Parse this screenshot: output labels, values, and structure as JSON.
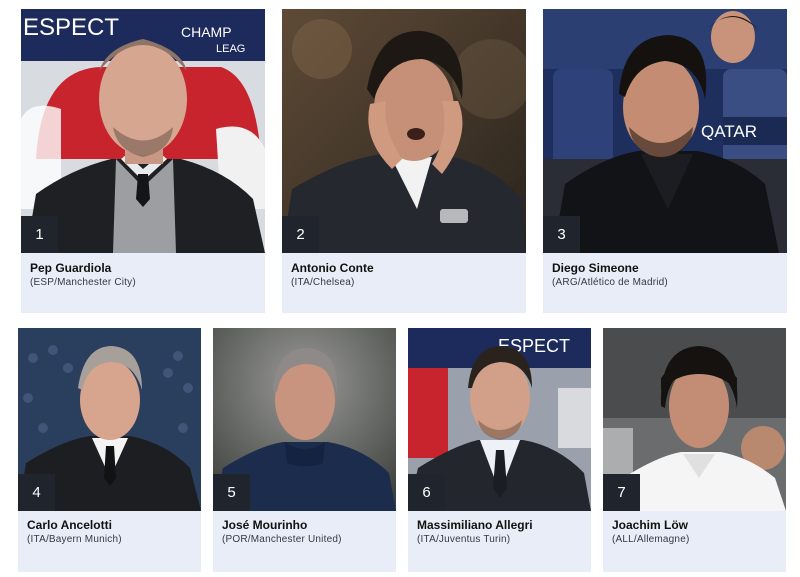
{
  "coaches": [
    {
      "rank": "1",
      "name": "Pep Guardiola",
      "club": "(ESP/Manchester City)",
      "backdrop_text": "ESPECT",
      "backdrop_text2": "CHAMPIONS LEAGUE"
    },
    {
      "rank": "2",
      "name": "Antonio Conte",
      "club": "(ITA/Chelsea)"
    },
    {
      "rank": "3",
      "name": "Diego Simeone",
      "club": "(ARG/Atlético de Madrid)",
      "backdrop_text": "QATAR"
    },
    {
      "rank": "4",
      "name": "Carlo Ancelotti",
      "club": "(ITA/Bayern Munich)"
    },
    {
      "rank": "5",
      "name": "José Mourinho",
      "club": "(POR/Manchester United)"
    },
    {
      "rank": "6",
      "name": "Massimiliano Allegri",
      "club": "(ITA/Juventus Turin)",
      "backdrop_text": "ESPECT"
    },
    {
      "rank": "7",
      "name": "Joachim Löw",
      "club": "(ALL/Allemagne)"
    }
  ],
  "colors": {
    "card_background": "#e9edf7",
    "rank_badge": "#20252d",
    "name_text": "#111111",
    "club_text": "#333a44"
  }
}
